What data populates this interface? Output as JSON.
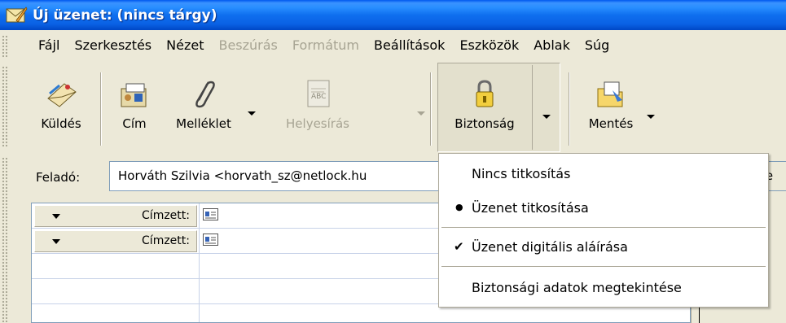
{
  "window": {
    "title": "Új üzenet: (nincs tárgy)"
  },
  "menubar": {
    "items": [
      {
        "label": "Fájl",
        "disabled": false
      },
      {
        "label": "Szerkesztés",
        "disabled": false
      },
      {
        "label": "Nézet",
        "disabled": false
      },
      {
        "label": "Beszúrás",
        "disabled": true
      },
      {
        "label": "Formátum",
        "disabled": true
      },
      {
        "label": "Beállítások",
        "disabled": false
      },
      {
        "label": "Eszközök",
        "disabled": false
      },
      {
        "label": "Ablak",
        "disabled": false
      },
      {
        "label": "Súg",
        "disabled": false
      }
    ]
  },
  "toolbar": {
    "send_label": "Küldés",
    "address_label": "Cím",
    "attach_label": "Melléklet",
    "spell_label": "Helyesírás",
    "security_label": "Biztonság",
    "save_label": "Mentés"
  },
  "header": {
    "from_label": "Feladó:",
    "from_value": "Horváth Szilvia <horvath_sz@netlock.hu",
    "right_edge_text": "te",
    "recipients": [
      {
        "type": "Címzett:"
      },
      {
        "type": "Címzett:"
      }
    ]
  },
  "security_menu": {
    "items": [
      {
        "label": "Nincs titkosítás",
        "mark": ""
      },
      {
        "label": "Üzenet titkosítása",
        "mark": "●"
      },
      {
        "label": "Üzenet digitális aláírása",
        "mark": "✔"
      },
      {
        "label": "Biztonsági adatok megtekintése",
        "mark": ""
      }
    ]
  },
  "colors": {
    "titlebar": "#0A61E4",
    "face": "#ECE9D8",
    "disabled_text": "#A7A493",
    "border": "#7F9DB9"
  }
}
